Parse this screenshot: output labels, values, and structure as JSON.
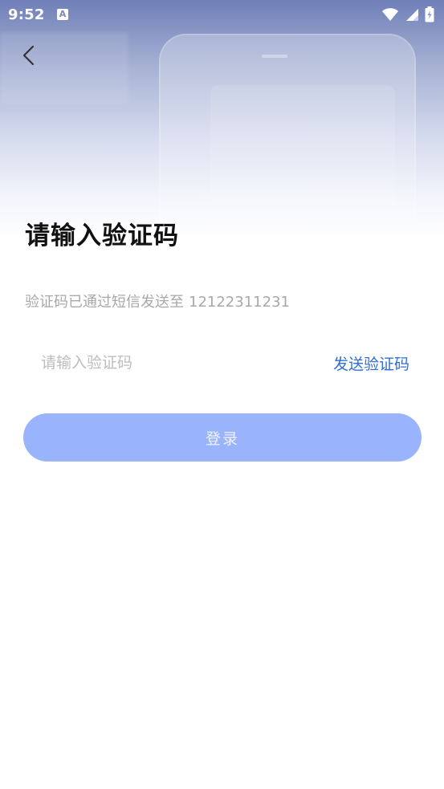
{
  "status_bar": {
    "time": "9:52",
    "notification_letter": "A"
  },
  "header": {
    "title": "请输入验证码",
    "sms_tip": "验证码已通过短信发送至",
    "phone_number": "12122311231"
  },
  "form": {
    "code_placeholder": "请输入验证码",
    "send_code_label": "发送验证码",
    "login_label": "登录"
  },
  "colors": {
    "accent": "#2f6fd1",
    "login_button": "#99b3fd",
    "hero_top": "#6f7fb8"
  }
}
